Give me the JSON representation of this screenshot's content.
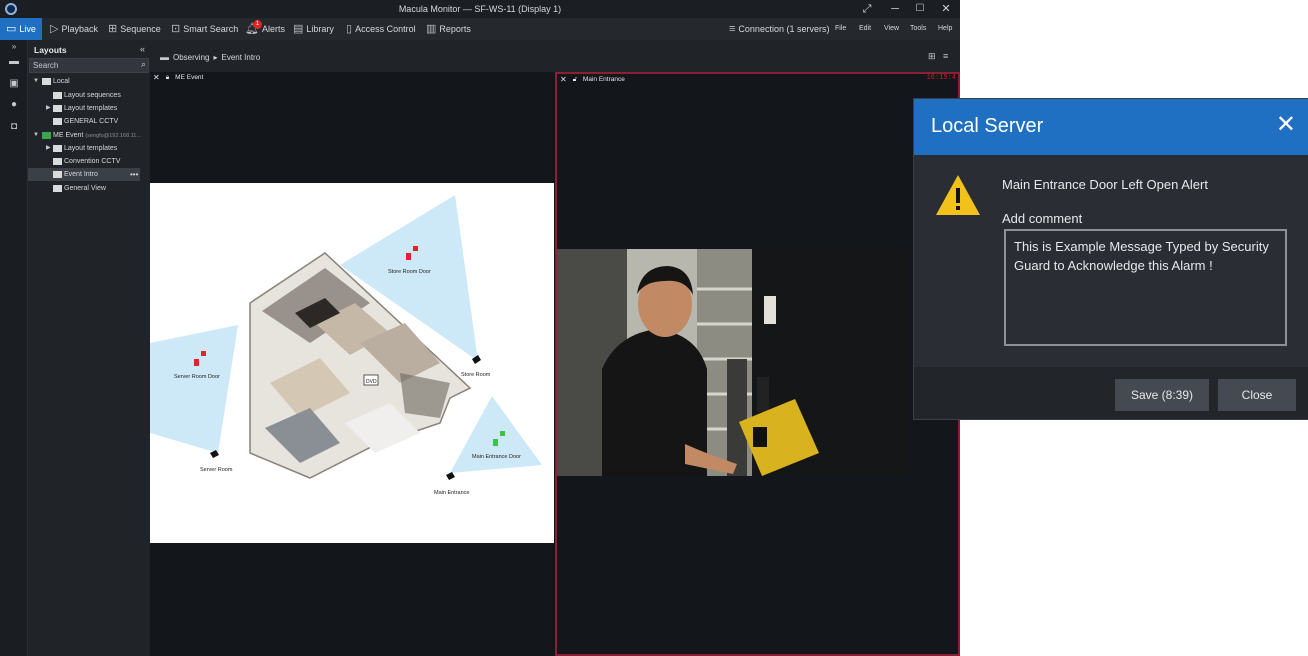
{
  "window": {
    "title": "Macula Monitor — SF-WS-11 (Display 1)"
  },
  "toolbar": {
    "live": "Live",
    "playback": "Playback",
    "sequence": "Sequence",
    "smart_search": "Smart Search",
    "alerts": "Alerts",
    "alerts_count": "1",
    "library": "Library",
    "access_control": "Access Control",
    "reports": "Reports",
    "connection": "Connection (1 servers)",
    "file": "File",
    "edit": "Edit",
    "view": "View",
    "tools": "Tools",
    "help": "Help"
  },
  "layouts_panel": {
    "header": "Layouts",
    "search_placeholder": "Search",
    "items": [
      {
        "label": "Local"
      },
      {
        "label": "Layout sequences"
      },
      {
        "label": "Layout templates"
      },
      {
        "label": "GENERAL CCTV"
      },
      {
        "label": "ME Event",
        "sub": "(sengfu@192.168.11..."
      },
      {
        "label": "Layout templates"
      },
      {
        "label": "Convention CCTV"
      },
      {
        "label": "Event Intro",
        "more": "•••"
      },
      {
        "label": "General View"
      }
    ]
  },
  "breadcrumb": {
    "root": "Observing",
    "current": "Event Intro"
  },
  "panes": {
    "left_title": "ME Event",
    "right_title": "Main Entrance",
    "timecode": "16:15:4"
  },
  "map": {
    "labels": {
      "store_room_door": "Store Room Door",
      "server_room_door": "Server Room Door",
      "store_room": "Store Room",
      "server_room": "Server Room",
      "main_entrance_door": "Main Entrance Door",
      "main_entrance": "Main Entrance",
      "tv_label": "DVD"
    },
    "colors": {
      "fov": "#cde9f7",
      "locked": "#e0232c",
      "unlocked": "#3cc43c"
    }
  },
  "dialog": {
    "title": "Local Server",
    "message": "Main Entrance Door Left Open Alert",
    "comment_label": "Add comment",
    "comment_value": "This is Example Message Typed by Security Guard to Acknowledge this Alarm !",
    "save_label": "Save (8:39)",
    "close_label": "Close",
    "accent": "#1f6fc2"
  }
}
